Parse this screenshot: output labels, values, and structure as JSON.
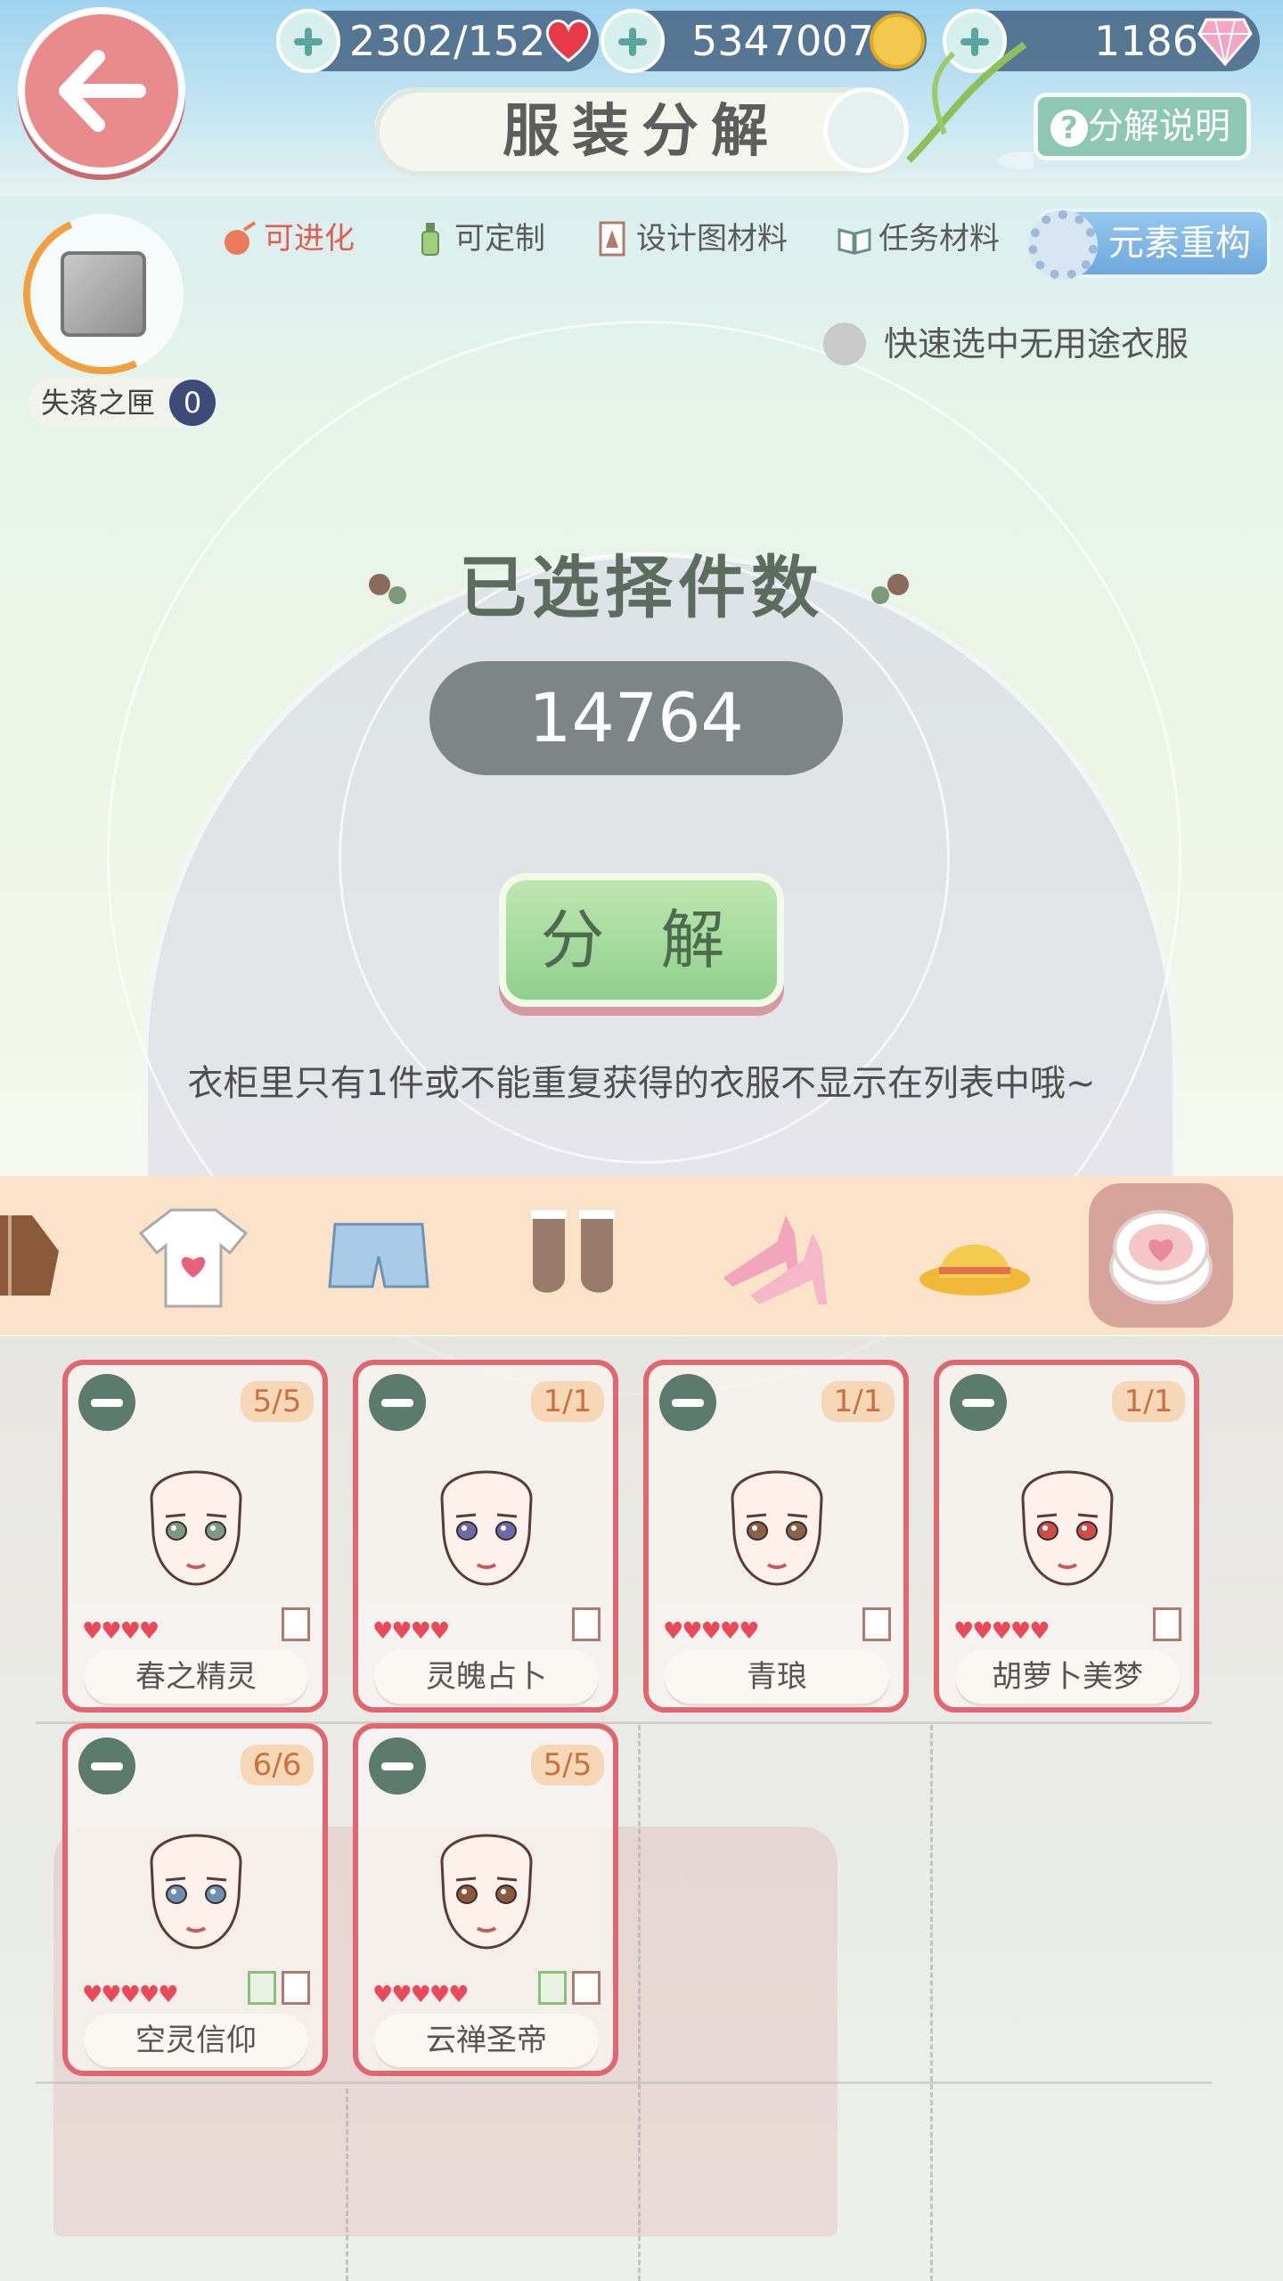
{
  "header": {
    "stamina": "2302/152",
    "gold": "5347007",
    "diamonds": "1186",
    "title": "服装分解",
    "help_label": "分解说明"
  },
  "filters": {
    "evolvable": "可进化",
    "customizable": "可定制",
    "design_material": "设计图材料",
    "task_material": "任务材料",
    "rebuild": "元素重构",
    "quick_select": "快速选中无用途衣服"
  },
  "lost_box": {
    "label": "失落之匣",
    "count": "0"
  },
  "selection": {
    "title": "已选择件数",
    "count": "14764",
    "decompose_label": "分 解",
    "hint": "衣柜里只有1件或不能重复获得的衣服不显示在列表中哦~"
  },
  "categories": [
    {
      "name": "coat",
      "active": false
    },
    {
      "name": "top",
      "active": false
    },
    {
      "name": "bottom",
      "active": false
    },
    {
      "name": "socks",
      "active": false
    },
    {
      "name": "shoes",
      "active": false
    },
    {
      "name": "hat",
      "active": false
    },
    {
      "name": "makeup",
      "active": true
    }
  ],
  "items": [
    {
      "name": "春之精灵",
      "qty": "5/5",
      "stars": "♥♥♥♥",
      "eye": "#7a9a86"
    },
    {
      "name": "灵魄占卜",
      "qty": "1/1",
      "stars": "♥♥♥♥",
      "eye": "#6e6aa8"
    },
    {
      "name": "青琅",
      "qty": "1/1",
      "stars": "♥♥♥♥♥",
      "eye": "#8a6248"
    },
    {
      "name": "胡萝卜美梦",
      "qty": "1/1",
      "stars": "♥♥♥♥♥",
      "eye": "#d24b4b"
    },
    {
      "name": "空灵信仰",
      "qty": "6/6",
      "stars": "♥♥♥♥♥",
      "eye": "#6d8fb0"
    },
    {
      "name": "云禅圣帝",
      "qty": "5/5",
      "stars": "♥♥♥♥♥",
      "eye": "#8a5a3c"
    }
  ],
  "colors": {
    "card_border": "#e06670",
    "accent_green": "#8fd08e",
    "heart": "#e94a5a"
  }
}
